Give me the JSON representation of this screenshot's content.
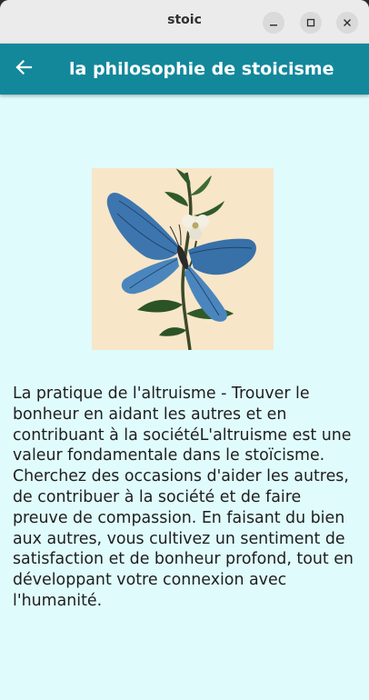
{
  "window": {
    "title": "stoic",
    "controls": {
      "minimize_icon": "minimize-icon",
      "maximize_icon": "maximize-icon",
      "close_icon": "close-icon"
    }
  },
  "appbar": {
    "back_icon": "arrow-left-icon",
    "title": "la philosophie de stoicisme",
    "color": "#13889b"
  },
  "content": {
    "image_subject": "blue butterfly on a flowering branch",
    "background_color": "#e0fbfc",
    "text": "La pratique de l'altruisme - Trouver le bonheur en aidant les autres et en contribuant à la sociétéL'altruisme est une valeur fondamentale dans le stoïcisme. Cherchez des occasions d'aider les autres, de contribuer à la société et de faire preuve de compassion. En faisant du bien aux autres, vous cultivez un sentiment de satisfaction et de bonheur profond, tout en développant votre connexion avec l'humanité."
  }
}
